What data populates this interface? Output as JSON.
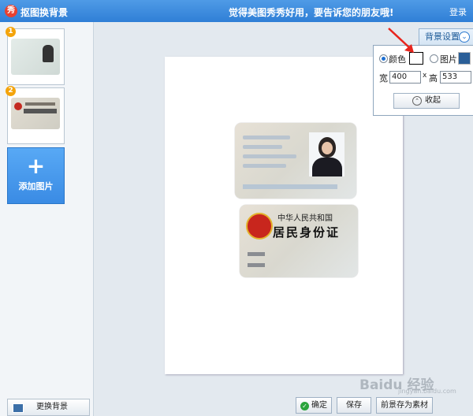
{
  "window": {
    "app_icon_glyph": "秀",
    "title": "抠图换背景",
    "promo": "觉得美图秀秀好用，要告诉您的朋友哦!",
    "login": "登录"
  },
  "sidebar": {
    "thumbnails": [
      {
        "badge": "1"
      },
      {
        "badge": "2"
      }
    ],
    "add_button": {
      "icon": "plus-icon",
      "label": "添加图片"
    },
    "change_bg_label": "更换背景"
  },
  "card_back": {
    "country": "中华人民共和国",
    "title": "居民身份证"
  },
  "background_settings": {
    "tab_label": "背景设置",
    "color_label": "颜色",
    "image_label": "图片",
    "width_label": "宽",
    "width_value": "400",
    "times": "x",
    "height_label": "高",
    "height_value": "533",
    "collapse_label": "收起",
    "selected": "color",
    "color_value": "#ffffff"
  },
  "footer": {
    "confirm_label": "确定",
    "save_label": "保存",
    "save_as_material_label": "前景存为素材"
  },
  "watermark": {
    "text": "Baidu 经验",
    "url": "jingyan.baidu.com"
  }
}
